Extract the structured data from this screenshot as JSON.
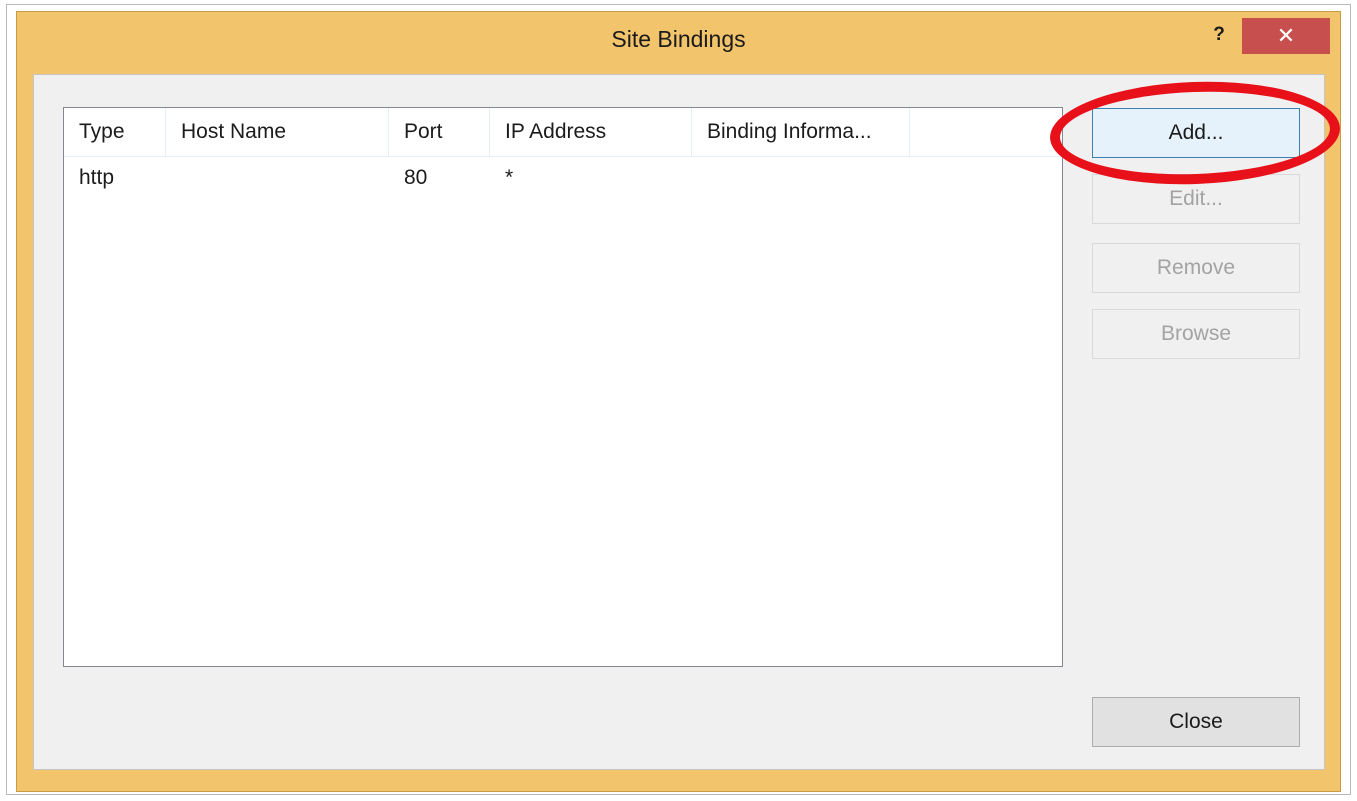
{
  "window": {
    "title": "Site Bindings",
    "help_glyph": "?",
    "close_glyph": "✕"
  },
  "bindings_table": {
    "columns": [
      "Type",
      "Host Name",
      "Port",
      "IP Address",
      "Binding Informa..."
    ],
    "rows": [
      {
        "type": "http",
        "host_name": "",
        "port": "80",
        "ip_address": "*",
        "binding_info": ""
      }
    ]
  },
  "buttons": {
    "add": "Add...",
    "edit": "Edit...",
    "remove": "Remove",
    "browse": "Browse",
    "close": "Close"
  },
  "colors": {
    "title_bar": "#f2c46b",
    "close_button": "#c7504e",
    "annotation": "#e8111a"
  },
  "annotation": {
    "shape": "ellipse",
    "target": "add-button"
  }
}
